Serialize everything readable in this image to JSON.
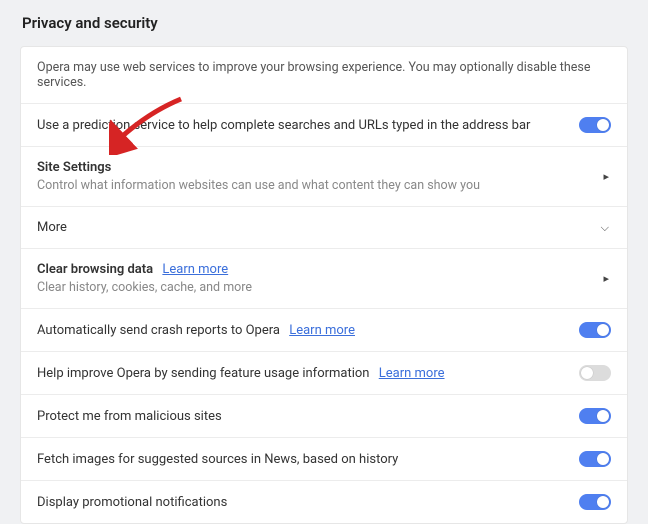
{
  "header": {
    "title": "Privacy and security"
  },
  "rows": {
    "intro": {
      "text": "Opera may use web services to improve your browsing experience. You may optionally disable these services."
    },
    "prediction": {
      "label": "Use a prediction service to help complete searches and URLs typed in the address bar",
      "toggle": true
    },
    "siteSettings": {
      "label": "Site Settings",
      "desc": "Control what information websites can use and what content they can show you"
    },
    "more": {
      "label": "More"
    },
    "clearData": {
      "label": "Clear browsing data",
      "learnMore": "Learn more",
      "desc": "Clear history, cookies, cache, and more"
    },
    "crashReports": {
      "label": "Automatically send crash reports to Opera",
      "learnMore": "Learn more",
      "toggle": true
    },
    "featureUsage": {
      "label": "Help improve Opera by sending feature usage information",
      "learnMore": "Learn more",
      "toggle": false
    },
    "protect": {
      "label": "Protect me from malicious sites",
      "toggle": true
    },
    "fetchImages": {
      "label": "Fetch images for suggested sources in News, based on history",
      "toggle": true
    },
    "promo": {
      "label": "Display promotional notifications",
      "toggle": true
    }
  }
}
